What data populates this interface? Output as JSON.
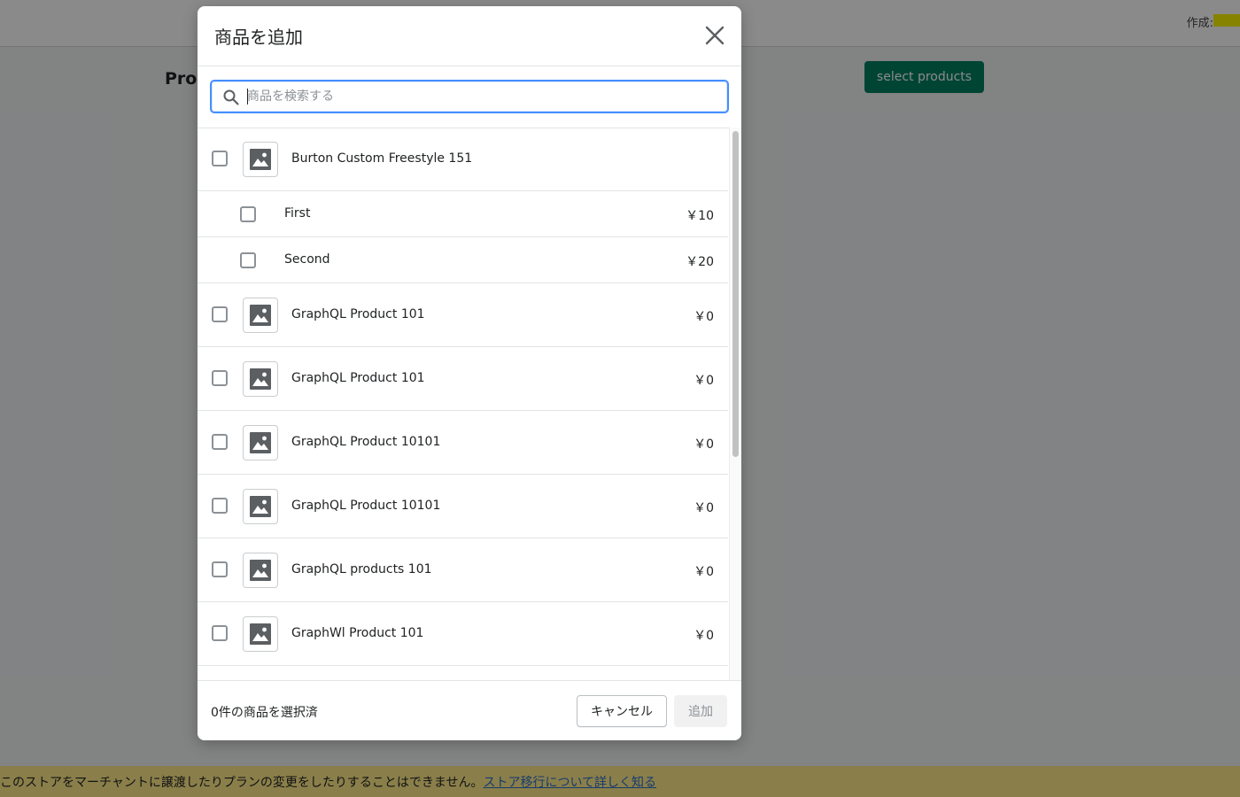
{
  "background": {
    "page_title": "Products",
    "created_label": "作成:",
    "select_products_label": "select products",
    "banner_text": "このストアをマーチャントに譲渡したりプランの変更をしたりすることはできません。",
    "banner_link": "ストア移行について詳しく知る"
  },
  "modal": {
    "title": "商品を追加",
    "search": {
      "placeholder": "商品を検索する",
      "value": ""
    },
    "items": [
      {
        "type": "product",
        "name": "Burton Custom Freestyle 151",
        "price": ""
      },
      {
        "type": "variant",
        "name": "First",
        "price": "￥10"
      },
      {
        "type": "variant",
        "name": "Second",
        "price": "￥20"
      },
      {
        "type": "product",
        "name": "GraphQL Product 101",
        "price": "￥0"
      },
      {
        "type": "product",
        "name": "GraphQL Product 101",
        "price": "￥0"
      },
      {
        "type": "product",
        "name": "GraphQL Product 10101",
        "price": "￥0"
      },
      {
        "type": "product",
        "name": "GraphQL Product 10101",
        "price": "￥0"
      },
      {
        "type": "product",
        "name": "GraphQL products 101",
        "price": "￥0"
      },
      {
        "type": "product",
        "name": "GraphWl Product 101",
        "price": "￥0"
      },
      {
        "type": "product",
        "name": "",
        "price": ""
      }
    ],
    "footer": {
      "selected_count": "0件の商品を選択済",
      "cancel_label": "キャンセル",
      "add_label": "追加"
    }
  },
  "colors": {
    "primary_button": "#008060",
    "focus_border": "#458fff",
    "banner": "#ffea8a"
  },
  "icons": [
    "close-icon",
    "search-icon",
    "image-placeholder-icon"
  ]
}
